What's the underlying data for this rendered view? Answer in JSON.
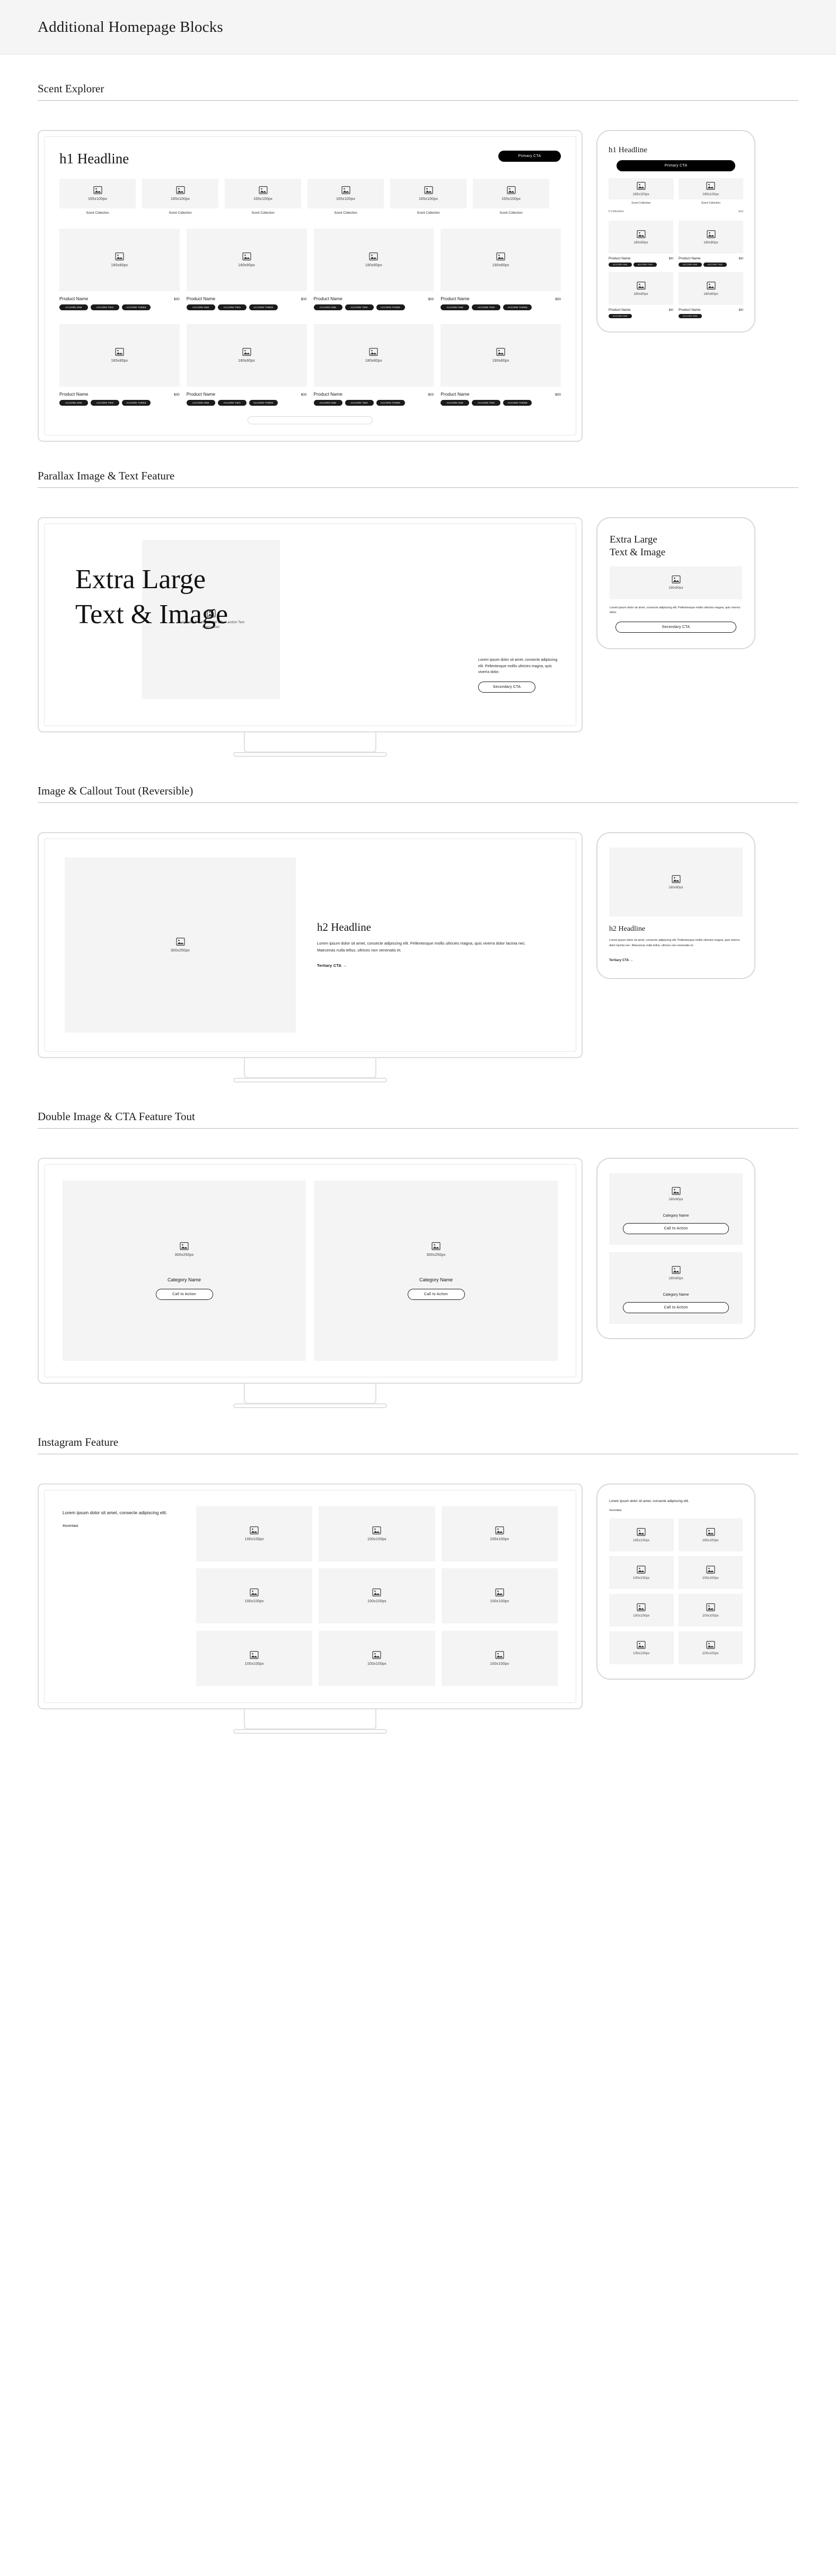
{
  "topbar": {
    "title": "Additional Homepage Blocks"
  },
  "placeholder": {
    "icon": "image-placeholder-icon",
    "size_165x100": "165x100px",
    "size_180x80": "180x80px",
    "size_300x250": "300x250px",
    "size_100x100": "100x100px",
    "caption_parallax": "Image with Parallax Scroll Effect and/or Text Intersected"
  },
  "sections": [
    {
      "id": "scent-explorer",
      "title": "Scent Explorer"
    },
    {
      "id": "parallax",
      "title": "Parallax Image & Text Feature"
    },
    {
      "id": "image-callout",
      "title": "Image & Callout Tout (Reversible)"
    },
    {
      "id": "double-image",
      "title": "Double Image & CTA Feature Tout"
    },
    {
      "id": "instagram",
      "title": "Instagram Feature"
    }
  ],
  "scent_explorer": {
    "headline": "h1 Headline",
    "primary_cta": "Primary CTA",
    "chip_label": "Scent Collection",
    "chips_desktop": [
      "Scent Collection",
      "Scent Collection",
      "Scent Collection",
      "Scent Collection",
      "Scent Collection",
      "Scent Collection"
    ],
    "chips_mobile": [
      "Scent Collection",
      "Scent Collection"
    ],
    "mobile_head_left": "6 Collections",
    "mobile_head_right": "Sort",
    "product": {
      "name": "Product Name",
      "price": "$00"
    },
    "badges": [
      "ACCORD ONE",
      "ACCORD TWO",
      "ACCORD THREE"
    ],
    "products_desktop": [
      {
        "name": "Product Name",
        "price": "$00"
      },
      {
        "name": "Product Name",
        "price": "$00"
      },
      {
        "name": "Product Name",
        "price": "$00"
      },
      {
        "name": "Product Name",
        "price": "$00"
      },
      {
        "name": "Product Name",
        "price": "$00"
      },
      {
        "name": "Product Name",
        "price": "$00"
      },
      {
        "name": "Product Name",
        "price": "$00"
      },
      {
        "name": "Product Name",
        "price": "$00"
      }
    ],
    "products_mobile": [
      {
        "name": "Product Name",
        "price": "$00"
      },
      {
        "name": "Product Name",
        "price": "$00"
      },
      {
        "name": "Product Name",
        "price": "$00"
      },
      {
        "name": "Product Name",
        "price": "$00"
      }
    ]
  },
  "parallax": {
    "headline_line1": "Extra Large",
    "headline_line2": "Text & Image",
    "mobile_headline_line1": "Extra Large",
    "mobile_headline_line2": "Text & Image",
    "body": "Lorem ipsum dolor sit amet, consecte adipiscing elit. Pellentesque mollis ultricies magna, quis viverra dolor.",
    "secondary_cta": "Secondary CTA"
  },
  "image_callout": {
    "headline": "h2 Headline",
    "body": "Lorem ipsum dolor sit amet, consecte adipiscing elit. Pellentesque mollis ultricies magna, quis viverra dolor lacinia nec. Maecenas nulla tellus, ultrices non venenatis et.",
    "tertiary_cta": "Tertiary CTA  →"
  },
  "double_image": {
    "category": "Category Name",
    "cta": "Call to Action",
    "columns": [
      {
        "category": "Category Name",
        "cta": "Call to Action"
      },
      {
        "category": "Category Name",
        "cta": "Call to Action"
      }
    ],
    "columns_mobile": [
      {
        "category": "Category Name",
        "cta": "Call to Action"
      },
      {
        "category": "Category Name",
        "cta": "Call to Action"
      }
    ]
  },
  "instagram": {
    "lead": "Lorem ipsum dolor sit amet, consecte adipiscing elit.",
    "handle": "#scentasi",
    "tiles_desktop": [
      "100x100px",
      "100x100px",
      "100x100px",
      "100x100px",
      "100x100px",
      "100x100px",
      "100x100px",
      "100x100px",
      "100x100px"
    ],
    "tiles_mobile": [
      "165x100px",
      "165x100px",
      "100x100px",
      "100x100px",
      "100x100px",
      "100x100px",
      "100x100px",
      "100x100px"
    ]
  },
  "colors": {
    "accent": "#000000",
    "surface": "#f4f4f4",
    "border": "#e0e0e0",
    "page_head_bg": "#f5f5f5"
  }
}
